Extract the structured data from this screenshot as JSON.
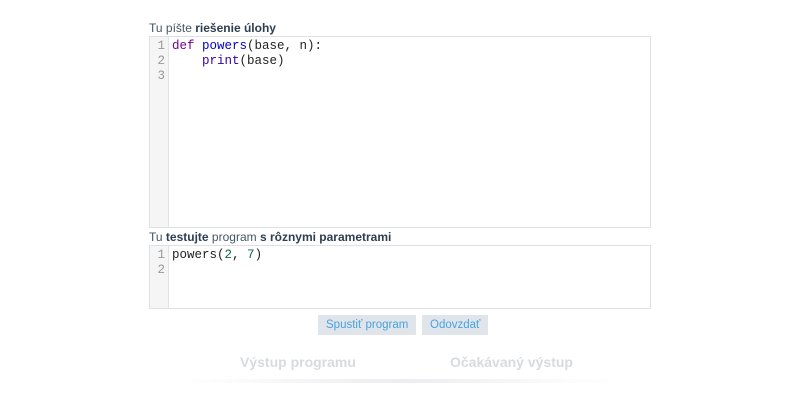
{
  "solution": {
    "label_prefix": "Tu píšte ",
    "label_bold": "riešenie úlohy",
    "line_numbers": [
      "1",
      "2",
      "3"
    ],
    "lines": [
      {
        "kw": "def",
        "fn": "powers",
        "rest": "(base, n):"
      },
      {
        "indent": "    ",
        "bi": "print",
        "rest": "(base)"
      },
      {
        "rest": ""
      }
    ]
  },
  "tests": {
    "label_1": "Tu ",
    "label_bold_1": "testujte",
    "label_2": " program ",
    "label_bold_2": "s rôznymi parametrami",
    "line_numbers": [
      "1",
      "2"
    ],
    "lines": [
      {
        "fn": "powers(",
        "n1": "2",
        "sep": ", ",
        "n2": "7",
        "end": ")"
      },
      {
        "rest": ""
      }
    ]
  },
  "buttons": {
    "run_label": "Spustiť program",
    "submit_label": "Odovzdať"
  },
  "output": {
    "program_output_heading": "Výstup programu",
    "expected_output_heading": "Očakávaný výstup"
  }
}
